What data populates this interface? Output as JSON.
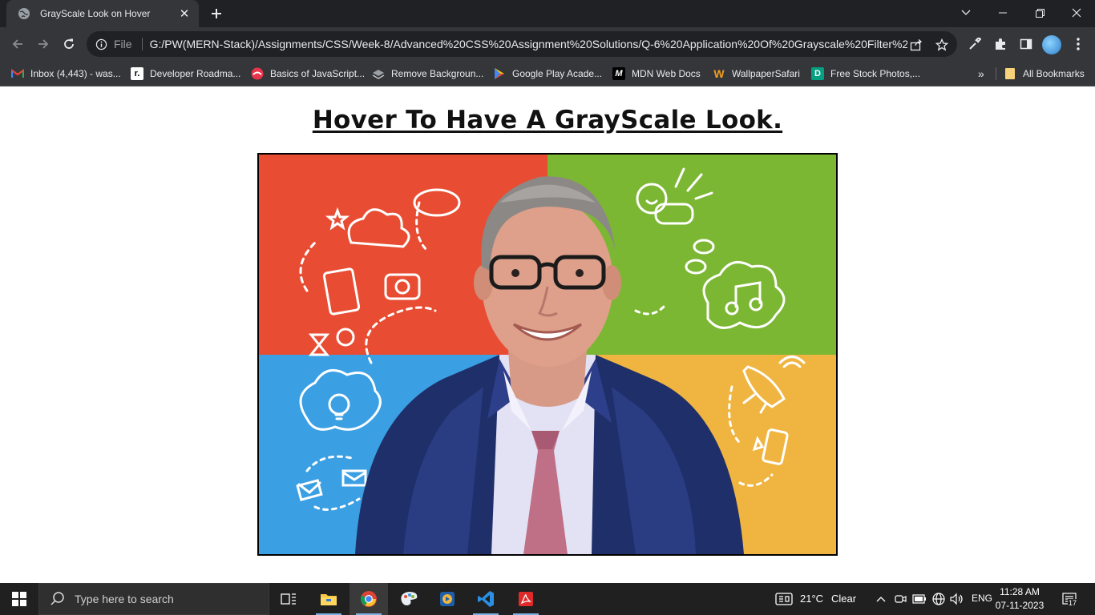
{
  "browser": {
    "tab": {
      "title": "GrayScale Look on Hover",
      "favicon": "globe-icon",
      "close_glyph": "✕"
    },
    "new_tab_icon": "plus-icon",
    "window_controls": [
      "minimize-icon",
      "restore-icon",
      "close-icon"
    ],
    "omnibox": {
      "scheme_label": "File",
      "url": "G:/PW(MERN-Stack)/Assignments/CSS/Week-8/Advanced%20CSS%20Assignment%20Solutions/Q-6%20Application%20Of%20Grayscale%20Filter%20..."
    },
    "bookmarks": [
      {
        "label": "Inbox (4,443) - was...",
        "icon": "gmail-icon"
      },
      {
        "label": "Developer Roadma...",
        "icon": "roadmap-icon"
      },
      {
        "label": "Basics of JavaScript...",
        "icon": "js-basics-icon"
      },
      {
        "label": "Remove Backgroun...",
        "icon": "remove-bg-icon"
      },
      {
        "label": "Google Play Acade...",
        "icon": "google-play-icon"
      },
      {
        "label": "MDN Web Docs",
        "icon": "mdn-icon"
      },
      {
        "label": "WallpaperSafari",
        "icon": "wallpapersafari-icon"
      },
      {
        "label": "Free Stock Photos,...",
        "icon": "stock-photos-icon"
      }
    ],
    "more_bookmarks": "»",
    "all_bookmarks": "All Bookmarks"
  },
  "page": {
    "heading": "Hover To Have A GrayScale Look."
  },
  "image_colors": {
    "top_left": "#e84d33",
    "top_right": "#7cb734",
    "bottom_left": "#3a9fe3",
    "bottom_right": "#f0b440"
  },
  "taskbar": {
    "search_placeholder": "Type here to search",
    "weather": {
      "temp": "21°C",
      "condition": "Clear"
    },
    "language": "ENG",
    "time": "11:28 AM",
    "date": "07-11-2023",
    "notification_count": "17"
  }
}
